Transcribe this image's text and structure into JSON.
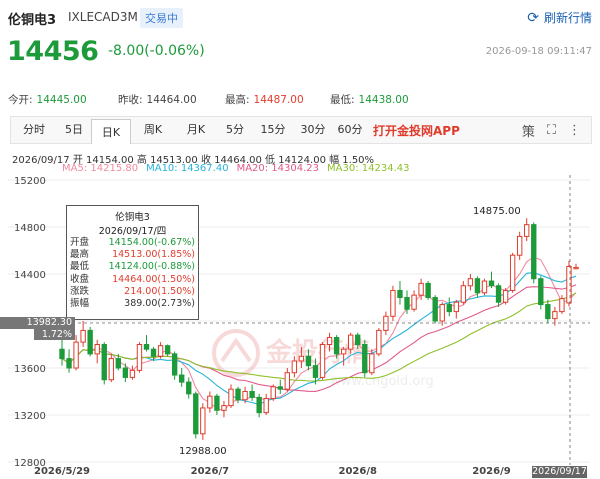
{
  "header": {
    "name": "伦铜电3",
    "code": "IXLECAD3M",
    "status": "交易中",
    "refresh_label": "刷新行情",
    "price": "14456",
    "change": "-8.00(-0.06%)",
    "time": "2026-09-18 09:11:47"
  },
  "stats": [
    {
      "label": "今开:",
      "value": "14445.00",
      "color": "#1d9a3a"
    },
    {
      "label": "昨收:",
      "value": "14464.00",
      "color": "#333333"
    },
    {
      "label": "最高:",
      "value": "14487.00",
      "color": "#e03c2d"
    },
    {
      "label": "最低:",
      "value": "14438.00",
      "color": "#1d9a3a"
    }
  ],
  "tabs": [
    "分时",
    "5日",
    "日K",
    "周K",
    "月K",
    "5分",
    "15分",
    "30分",
    "60分"
  ],
  "active_tab": "日K",
  "app_link": "打开金投网APP",
  "tools": [
    "策",
    "⛶",
    "⋮"
  ],
  "info_line": "2026/09/17  开 14154.00  高 14513.00  收 14464.00  低 14124.00  幅 1.50%",
  "ma": [
    {
      "label": "MA5: 14215.80",
      "color": "#f08aa0"
    },
    {
      "label": "MA10: 14367.40",
      "color": "#27b3d9"
    },
    {
      "label": "MA20: 14304.23",
      "color": "#e05a8a"
    },
    {
      "label": "MA30: 14234.43",
      "color": "#8fbf2a"
    }
  ],
  "tooltip": {
    "title": "伦铜电3",
    "date": "2026/09/17/四",
    "rows": [
      {
        "label": "开盘",
        "value": "14154.00(-0.67%)",
        "tone": "g"
      },
      {
        "label": "最高",
        "value": "14513.00(1.85%)",
        "tone": "r"
      },
      {
        "label": "最低",
        "value": "14124.00(-0.88%)",
        "tone": "g"
      },
      {
        "label": "收盘",
        "value": "14464.00(1.50%)",
        "tone": "r"
      },
      {
        "label": "涨跌",
        "value": "214.00(1.50%)",
        "tone": "r"
      },
      {
        "label": "振幅",
        "value": "389.00(2.73%)",
        "tone": "k"
      }
    ]
  },
  "crosshair": {
    "price": "13982.30",
    "pct": "1.72%",
    "date": "2026/09/17"
  },
  "annotations": {
    "high": "14875.00",
    "low": "12988.00"
  },
  "watermark": "金投行情",
  "watermark_url": "www.cngold.org",
  "colors": {
    "up": "#e03c2d",
    "down": "#1d9a3a"
  },
  "chart_data": {
    "type": "candlestick",
    "title": "",
    "ylim": [
      12800,
      15200
    ],
    "y_ticks": [
      "15200",
      "14800",
      "14400",
      "14000",
      "13600",
      "13200",
      "12800"
    ],
    "x_ticks": [
      "2026/5/29",
      "2026/7",
      "2026/8",
      "2026/9"
    ],
    "candles": [
      [
        13760,
        13900,
        13620,
        13680
      ],
      [
        13680,
        13760,
        13560,
        13600
      ],
      [
        13600,
        13880,
        13580,
        13820
      ],
      [
        13820,
        14000,
        13780,
        13920
      ],
      [
        13920,
        13950,
        13700,
        13720
      ],
      [
        13720,
        13840,
        13640,
        13800
      ],
      [
        13800,
        13820,
        13460,
        13500
      ],
      [
        13500,
        13720,
        13480,
        13680
      ],
      [
        13680,
        13720,
        13580,
        13600
      ],
      [
        13600,
        13640,
        13480,
        13520
      ],
      [
        13520,
        13620,
        13500,
        13580
      ],
      [
        13580,
        13820,
        13560,
        13800
      ],
      [
        13800,
        13880,
        13740,
        13760
      ],
      [
        13760,
        13780,
        13660,
        13700
      ],
      [
        13700,
        13820,
        13680,
        13790
      ],
      [
        13790,
        13800,
        13700,
        13720
      ],
      [
        13720,
        13740,
        13500,
        13540
      ],
      [
        13540,
        13600,
        13440,
        13480
      ],
      [
        13480,
        13520,
        13340,
        13380
      ],
      [
        13380,
        13400,
        13000,
        13040
      ],
      [
        13040,
        13300,
        12988,
        13260
      ],
      [
        13260,
        13400,
        13220,
        13360
      ],
      [
        13360,
        13380,
        13200,
        13240
      ],
      [
        13240,
        13320,
        13180,
        13280
      ],
      [
        13280,
        13460,
        13260,
        13420
      ],
      [
        13420,
        13440,
        13300,
        13330
      ],
      [
        13330,
        13440,
        13300,
        13400
      ],
      [
        13400,
        13460,
        13320,
        13350
      ],
      [
        13350,
        13380,
        13180,
        13220
      ],
      [
        13220,
        13380,
        13200,
        13340
      ],
      [
        13340,
        13460,
        13320,
        13440
      ],
      [
        13440,
        13500,
        13380,
        13420
      ],
      [
        13420,
        13600,
        13400,
        13560
      ],
      [
        13560,
        13700,
        13520,
        13660
      ],
      [
        13660,
        13780,
        13600,
        13700
      ],
      [
        13700,
        13760,
        13580,
        13620
      ],
      [
        13620,
        13680,
        13460,
        13520
      ],
      [
        13520,
        13820,
        13500,
        13800
      ],
      [
        13800,
        13900,
        13740,
        13860
      ],
      [
        13860,
        13880,
        13680,
        13720
      ],
      [
        13720,
        13780,
        13620,
        13760
      ],
      [
        13760,
        13900,
        13720,
        13880
      ],
      [
        13880,
        13900,
        13760,
        13800
      ],
      [
        13800,
        13840,
        13520,
        13560
      ],
      [
        13560,
        13760,
        13540,
        13720
      ],
      [
        13720,
        13940,
        13700,
        13920
      ],
      [
        13920,
        14080,
        13880,
        14040
      ],
      [
        14040,
        14300,
        14000,
        14260
      ],
      [
        14260,
        14340,
        14140,
        14200
      ],
      [
        14200,
        14260,
        14060,
        14100
      ],
      [
        14100,
        14260,
        14080,
        14220
      ],
      [
        14220,
        14360,
        14180,
        14320
      ],
      [
        14320,
        14340,
        14180,
        14200
      ],
      [
        14200,
        14220,
        13980,
        14000
      ],
      [
        14000,
        14160,
        13960,
        14140
      ],
      [
        14140,
        14200,
        14040,
        14080
      ],
      [
        14080,
        14180,
        14020,
        14160
      ],
      [
        14160,
        14340,
        14140,
        14300
      ],
      [
        14300,
        14400,
        14260,
        14360
      ],
      [
        14360,
        14380,
        14200,
        14240
      ],
      [
        14240,
        14360,
        14220,
        14340
      ],
      [
        14340,
        14420,
        14280,
        14300
      ],
      [
        14300,
        14320,
        14120,
        14160
      ],
      [
        14160,
        14280,
        14140,
        14260
      ],
      [
        14260,
        14580,
        14240,
        14560
      ],
      [
        14560,
        14760,
        14520,
        14720
      ],
      [
        14720,
        14875,
        14680,
        14820
      ],
      [
        14820,
        14840,
        14320,
        14360
      ],
      [
        14360,
        14380,
        14100,
        14140
      ],
      [
        14140,
        14180,
        13980,
        14020
      ],
      [
        14020,
        14120,
        13960,
        14080
      ],
      [
        14080,
        14220,
        14060,
        14190
      ],
      [
        14154,
        14513,
        14124,
        14464
      ],
      [
        14445,
        14487,
        14438,
        14456
      ]
    ]
  }
}
